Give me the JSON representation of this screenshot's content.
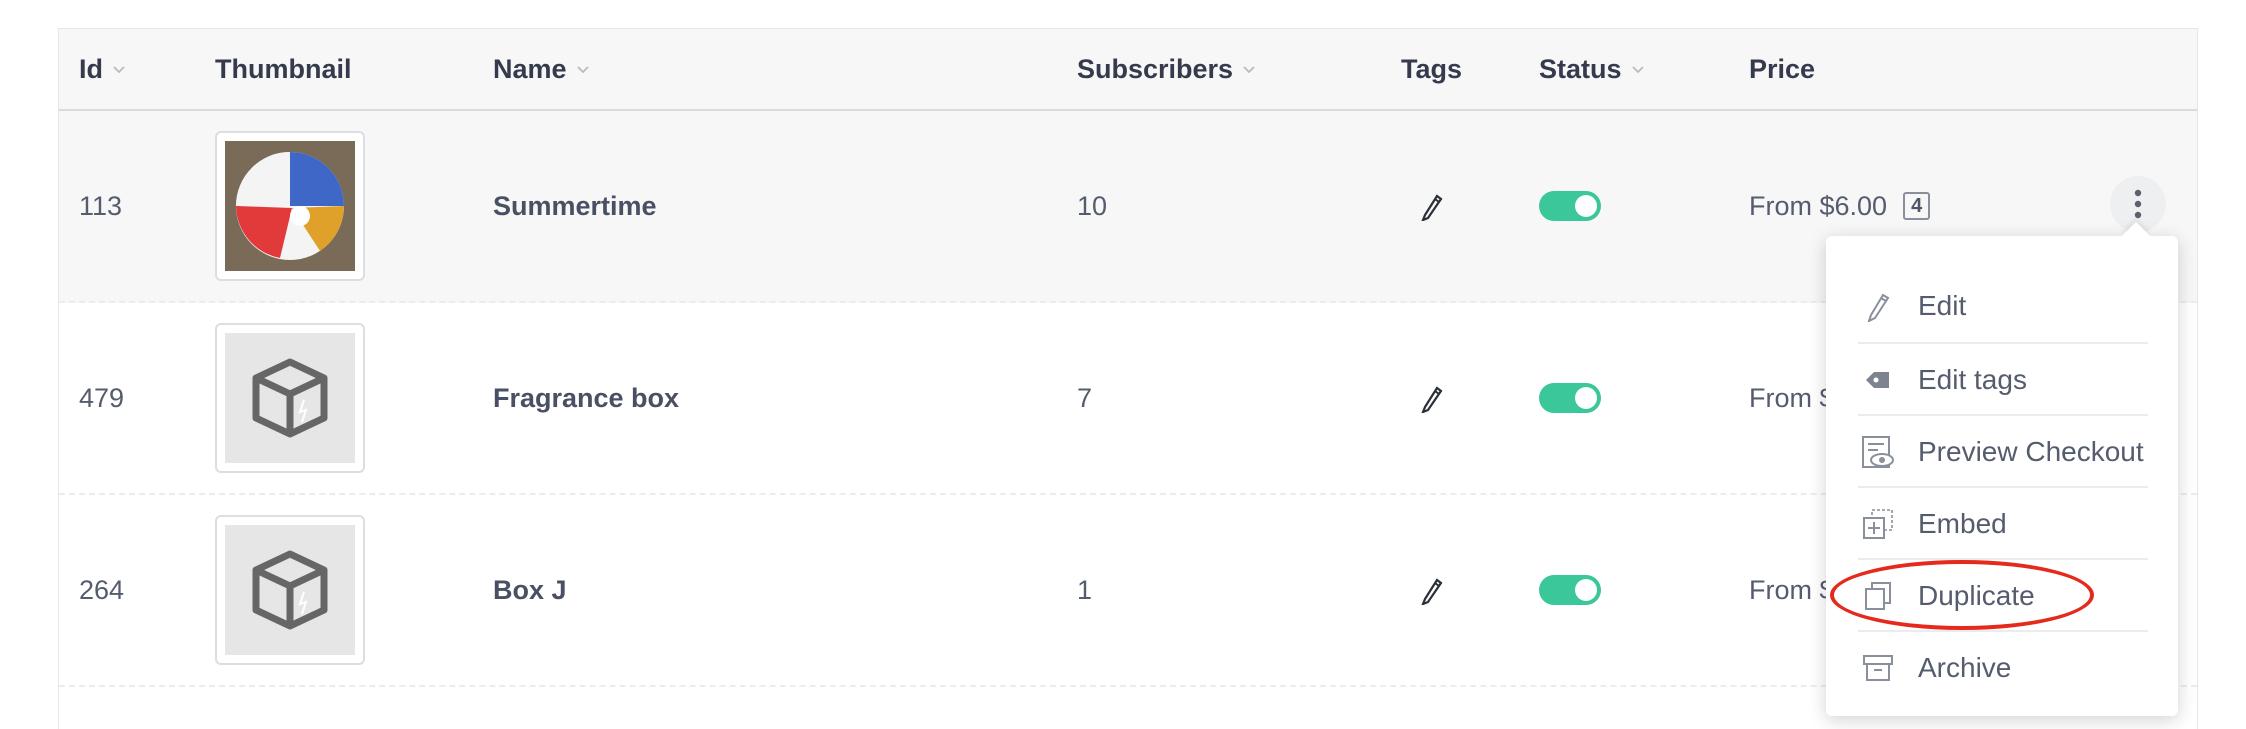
{
  "columns": {
    "id": "Id",
    "thumbnail": "Thumbnail",
    "name": "Name",
    "subscribers": "Subscribers",
    "tags": "Tags",
    "status": "Status",
    "price": "Price"
  },
  "rows": [
    {
      "id": "113",
      "name": "Summertime",
      "subscribers": "10",
      "price": "From $6.00",
      "price_badge": "4",
      "thumbnail": "beach-ball-image",
      "status_enabled": true
    },
    {
      "id": "479",
      "name": "Fragrance box",
      "subscribers": "7",
      "price": "From $",
      "thumbnail": "box-placeholder-icon",
      "status_enabled": true
    },
    {
      "id": "264",
      "name": "Box J",
      "subscribers": "1",
      "price": "From $",
      "thumbnail": "box-placeholder-icon",
      "status_enabled": true
    }
  ],
  "menu": {
    "items": [
      {
        "label": "Edit",
        "icon": "pencil-icon"
      },
      {
        "label": "Edit tags",
        "icon": "tag-icon"
      },
      {
        "label": "Preview Checkout",
        "icon": "preview-eye-icon"
      },
      {
        "label": "Embed",
        "icon": "embed-icon"
      },
      {
        "label": "Duplicate",
        "icon": "duplicate-icon"
      },
      {
        "label": "Archive",
        "icon": "archive-icon"
      }
    ]
  },
  "colors": {
    "toggle_on": "#3cc79a",
    "highlight_ring": "#e5291c",
    "header_bg": "#f7f7f8"
  }
}
